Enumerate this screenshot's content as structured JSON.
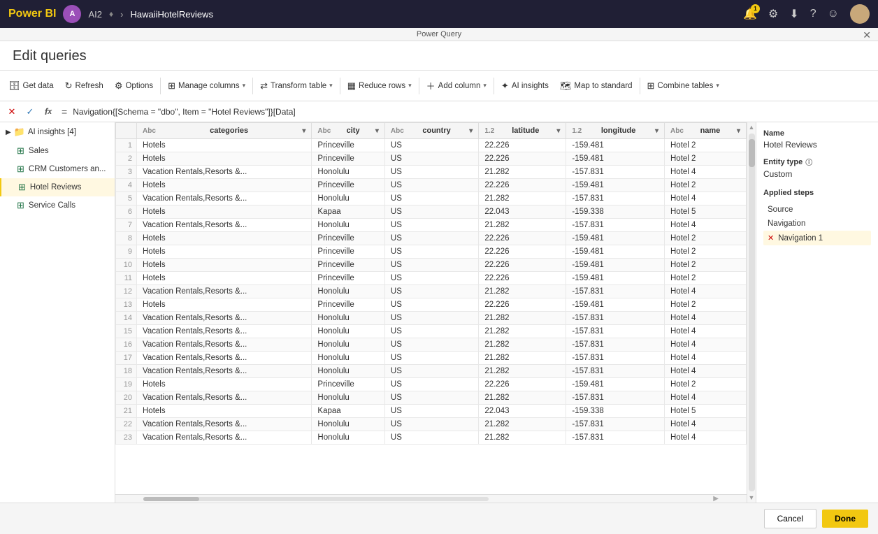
{
  "topbar": {
    "brand": "Power BI",
    "user_initial": "A",
    "ai_label": "AI2",
    "breadcrumb": [
      "HawaiiHotelReviews"
    ],
    "notification_count": "1"
  },
  "dialog": {
    "power_query_label": "Power Query",
    "title": "Edit queries"
  },
  "toolbar": {
    "get_data": "Get data",
    "refresh": "Refresh",
    "options": "Options",
    "manage_columns": "Manage columns",
    "transform_table": "Transform table",
    "reduce_rows": "Reduce rows",
    "add_column": "Add column",
    "ai_insights": "AI insights",
    "map_to_standard": "Map to standard",
    "combine_tables": "Combine tables"
  },
  "formula_bar": {
    "formula": "Navigation{[Schema = \"dbo\", Item = \"Hotel Reviews\"]}[Data]"
  },
  "sidebar": {
    "group_label": "AI insights [4]",
    "items": [
      {
        "id": "sales",
        "label": "Sales",
        "icon": "table"
      },
      {
        "id": "crm",
        "label": "CRM Customers an...",
        "icon": "table"
      },
      {
        "id": "hotel-reviews",
        "label": "Hotel Reviews",
        "icon": "table",
        "active": true
      },
      {
        "id": "service-calls",
        "label": "Service Calls",
        "icon": "table"
      }
    ]
  },
  "table": {
    "columns": [
      {
        "id": "categories",
        "label": "categories",
        "type": "Abc"
      },
      {
        "id": "city",
        "label": "city",
        "type": "Abc"
      },
      {
        "id": "country",
        "label": "country",
        "type": "Abc"
      },
      {
        "id": "latitude",
        "label": "latitude",
        "type": "1.2"
      },
      {
        "id": "longitude",
        "label": "longitude",
        "type": "1.2"
      },
      {
        "id": "name",
        "label": "name",
        "type": "Abc"
      }
    ],
    "rows": [
      [
        1,
        "Hotels",
        "Princeville",
        "US",
        "22.226",
        "-159.481",
        "Hotel 2"
      ],
      [
        2,
        "Hotels",
        "Princeville",
        "US",
        "22.226",
        "-159.481",
        "Hotel 2"
      ],
      [
        3,
        "Vacation Rentals,Resorts &...",
        "Honolulu",
        "US",
        "21.282",
        "-157.831",
        "Hotel 4"
      ],
      [
        4,
        "Hotels",
        "Princeville",
        "US",
        "22.226",
        "-159.481",
        "Hotel 2"
      ],
      [
        5,
        "Vacation Rentals,Resorts &...",
        "Honolulu",
        "US",
        "21.282",
        "-157.831",
        "Hotel 4"
      ],
      [
        6,
        "Hotels",
        "Kapaa",
        "US",
        "22.043",
        "-159.338",
        "Hotel 5"
      ],
      [
        7,
        "Vacation Rentals,Resorts &...",
        "Honolulu",
        "US",
        "21.282",
        "-157.831",
        "Hotel 4"
      ],
      [
        8,
        "Hotels",
        "Princeville",
        "US",
        "22.226",
        "-159.481",
        "Hotel 2"
      ],
      [
        9,
        "Hotels",
        "Princeville",
        "US",
        "22.226",
        "-159.481",
        "Hotel 2"
      ],
      [
        10,
        "Hotels",
        "Princeville",
        "US",
        "22.226",
        "-159.481",
        "Hotel 2"
      ],
      [
        11,
        "Hotels",
        "Princeville",
        "US",
        "22.226",
        "-159.481",
        "Hotel 2"
      ],
      [
        12,
        "Vacation Rentals,Resorts &...",
        "Honolulu",
        "US",
        "21.282",
        "-157.831",
        "Hotel 4"
      ],
      [
        13,
        "Hotels",
        "Princeville",
        "US",
        "22.226",
        "-159.481",
        "Hotel 2"
      ],
      [
        14,
        "Vacation Rentals,Resorts &...",
        "Honolulu",
        "US",
        "21.282",
        "-157.831",
        "Hotel 4"
      ],
      [
        15,
        "Vacation Rentals,Resorts &...",
        "Honolulu",
        "US",
        "21.282",
        "-157.831",
        "Hotel 4"
      ],
      [
        16,
        "Vacation Rentals,Resorts &...",
        "Honolulu",
        "US",
        "21.282",
        "-157.831",
        "Hotel 4"
      ],
      [
        17,
        "Vacation Rentals,Resorts &...",
        "Honolulu",
        "US",
        "21.282",
        "-157.831",
        "Hotel 4"
      ],
      [
        18,
        "Vacation Rentals,Resorts &...",
        "Honolulu",
        "US",
        "21.282",
        "-157.831",
        "Hotel 4"
      ],
      [
        19,
        "Hotels",
        "Princeville",
        "US",
        "22.226",
        "-159.481",
        "Hotel 2"
      ],
      [
        20,
        "Vacation Rentals,Resorts &...",
        "Honolulu",
        "US",
        "21.282",
        "-157.831",
        "Hotel 4"
      ],
      [
        21,
        "Hotels",
        "Kapaa",
        "US",
        "22.043",
        "-159.338",
        "Hotel 5"
      ],
      [
        22,
        "Vacation Rentals,Resorts &...",
        "Honolulu",
        "US",
        "21.282",
        "-157.831",
        "Hotel 4"
      ],
      [
        23,
        "Vacation Rentals,Resorts &...",
        "Honolulu",
        "US",
        "21.282",
        "-157.831",
        "Hotel 4"
      ]
    ]
  },
  "right_panel": {
    "name_label": "Name",
    "name_value": "Hotel Reviews",
    "entity_type_label": "Entity type",
    "entity_type_info": "ℹ",
    "entity_type_value": "Custom",
    "applied_steps_label": "Applied steps",
    "steps": [
      {
        "id": "source",
        "label": "Source",
        "deletable": false
      },
      {
        "id": "navigation",
        "label": "Navigation",
        "deletable": false
      },
      {
        "id": "navigation1",
        "label": "Navigation 1",
        "deletable": true,
        "active": true
      }
    ]
  },
  "footer": {
    "cancel_label": "Cancel",
    "done_label": "Done"
  }
}
